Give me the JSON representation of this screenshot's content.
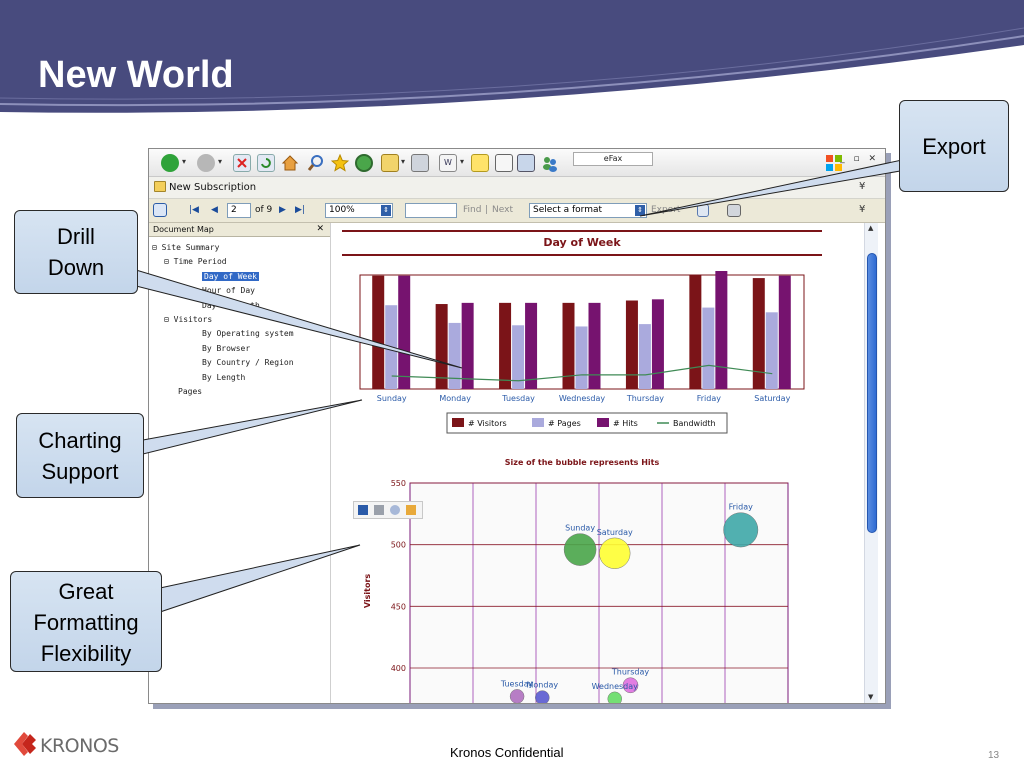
{
  "slide": {
    "title": "New World",
    "footer": "Kronos Confidential",
    "page_number": "13",
    "logo_text": "KRONOS",
    "header_color": "#484b7e"
  },
  "callouts": {
    "export": "Export",
    "drill_down": "Drill\nDown",
    "charting": "Charting\nSupport",
    "formatting": "Great\nFormatting\nFlexibility"
  },
  "browser": {
    "toolbar_icons": [
      "back-icon",
      "forward-icon",
      "stop-icon",
      "refresh-icon",
      "home-icon",
      "search-icon",
      "favorites-icon",
      "history-icon",
      "mail-icon",
      "print-icon",
      "edit-icon",
      "note-icon",
      "page-icon",
      "research-icon",
      "messenger-icon"
    ],
    "efax_label": "eFax",
    "favorites_item": "New Subscription"
  },
  "report_toolbar": {
    "page_value": "2",
    "page_of": "of 9",
    "zoom": "100%",
    "find_value": "",
    "find": "Find",
    "separator": "|",
    "next": "Next",
    "format_select": "Select a format",
    "export": "Export"
  },
  "doc_map": {
    "title": "Document Map",
    "items": [
      {
        "label": "Site Summary",
        "level": 0,
        "expander": "⊟"
      },
      {
        "label": "Time Period",
        "level": 1,
        "expander": "⊟"
      },
      {
        "label": "Day of Week",
        "level": 2,
        "selected": true
      },
      {
        "label": "Hour of Day",
        "level": 2
      },
      {
        "label": "Day of Month",
        "level": 2
      },
      {
        "label": "Visitors",
        "level": 1,
        "expander": "⊟"
      },
      {
        "label": "By Operating system",
        "level": 2
      },
      {
        "label": "By Browser",
        "level": 2
      },
      {
        "label": "By Country / Region",
        "level": 2
      },
      {
        "label": "By Length",
        "level": 2
      },
      {
        "label": "Pages",
        "level": 1
      }
    ]
  },
  "chart_data": [
    {
      "type": "bar",
      "title": "Day of Week",
      "categories": [
        "Sunday",
        "Monday",
        "Tuesday",
        "Wednesday",
        "Thursday",
        "Friday",
        "Saturday"
      ],
      "series": [
        {
          "name": "# Visitors",
          "values": [
            96,
            72,
            73,
            73,
            75,
            97,
            94
          ],
          "color": "#7b1418"
        },
        {
          "name": "# Pages",
          "values": [
            71,
            56,
            54,
            53,
            55,
            69,
            65
          ],
          "color": "#aaaadd"
        },
        {
          "name": "# Hits",
          "values": [
            96,
            73,
            73,
            73,
            76,
            100,
            96
          ],
          "color": "#76136f"
        },
        {
          "name": "Bandwidth",
          "type": "line",
          "values": [
            11,
            9,
            7,
            12,
            12,
            20,
            13
          ],
          "color": "#3f8a55"
        }
      ],
      "ylim": [
        0,
        100
      ],
      "legend": "bottom"
    },
    {
      "type": "scatter",
      "title": "Size of the bubble represents Hits",
      "ylabel": "Visitors",
      "y_ticks": [
        "550",
        "500",
        "450",
        "400"
      ],
      "ylim": [
        370,
        550
      ],
      "xlim": [
        0,
        6
      ],
      "points": [
        {
          "label": "Sunday",
          "x": 2.7,
          "y": 496,
          "size": 1.0,
          "color": "#4aa64a"
        },
        {
          "label": "Saturday",
          "x": 3.25,
          "y": 493,
          "size": 0.95,
          "color": "#ffff33"
        },
        {
          "label": "Friday",
          "x": 5.25,
          "y": 512,
          "size": 1.1,
          "color": "#3fa9a9"
        },
        {
          "label": "Thursday",
          "x": 3.5,
          "y": 386,
          "size": 0.3,
          "color": "#e070e0"
        },
        {
          "label": "Monday",
          "x": 2.1,
          "y": 376,
          "size": 0.25,
          "color": "#5a5ad0"
        },
        {
          "label": "Tuesday",
          "x": 1.7,
          "y": 377,
          "size": 0.25,
          "color": "#b070c0"
        },
        {
          "label": "Wednesday",
          "x": 3.25,
          "y": 375,
          "size": 0.25,
          "color": "#66dd66"
        }
      ]
    }
  ]
}
